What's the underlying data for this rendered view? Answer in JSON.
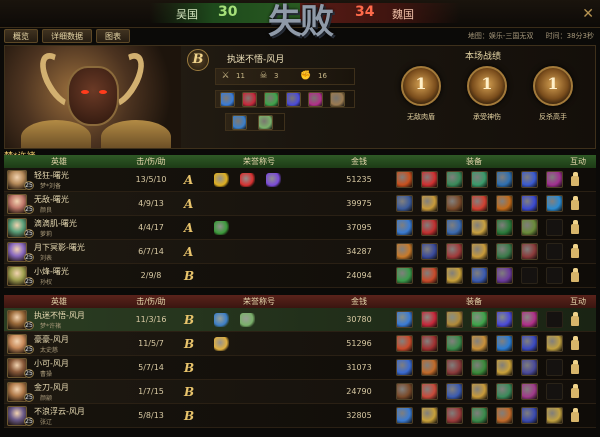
{
  "header": {
    "left_team": "吴国",
    "left_score": "30",
    "right_team": "魏国",
    "right_score": "34",
    "result": "失败",
    "close_icon": "close-icon"
  },
  "tabs": [
    {
      "label": "概览"
    },
    {
      "label": "详细数据"
    },
    {
      "label": "图表"
    }
  ],
  "meta": {
    "map": "地图：娱乐-三国无双",
    "time": "时间：38分3秒"
  },
  "mvp": {
    "grade": "B",
    "name": "执迷不悟-风月",
    "stats": [
      {
        "icon": "swords-icon",
        "value": "11"
      },
      {
        "icon": "skull-icon",
        "value": "3"
      },
      {
        "icon": "fist-icon",
        "value": "16"
      }
    ],
    "items": [
      "#3a7bd5",
      "#c6283a",
      "#3fa34a",
      "#4b4bd8",
      "#b03088",
      "#9a7a50"
    ],
    "titles": [
      "#3c7fc8",
      "#7ab06a"
    ]
  },
  "record": {
    "title": "本场战绩",
    "medals": [
      {
        "num": "1",
        "label": "无敌肉盾"
      },
      {
        "num": "1",
        "label": "承受神伤"
      },
      {
        "num": "1",
        "label": "反杀高手"
      }
    ]
  },
  "section_name": "梦*许褚",
  "columns": {
    "hero": "英雄",
    "kda": "击/伤/助",
    "title": "荣誉称号",
    "gold": "金钱",
    "equip": "装备",
    "interact": "互动"
  },
  "team_green": [
    {
      "hero": "轻狂-曙光",
      "player": "梦*刘备",
      "lvl": "25",
      "kda": "13/5/10",
      "grade": "A",
      "gold": "51235",
      "avatar": "#b58a5a",
      "titles": [
        "#e0b020",
        "#d83030",
        "#7a4ad8"
      ],
      "items": [
        "#c8501e",
        "#d03030",
        "#3a8a5a",
        "#3a9a6a",
        "#2e6fb0",
        "#3a5ad0",
        "#a03090"
      ]
    },
    {
      "hero": "无敌-曙光",
      "player": "颜良",
      "lvl": "25",
      "kda": "4/9/13",
      "grade": "A",
      "gold": "39975",
      "avatar": "#c0786a",
      "titles": [],
      "items": [
        "#3a5a9a",
        "#c89a3a",
        "#7a4a2a",
        "#d04030",
        "#c06a1a",
        "#3a4ad0",
        "#2a8ad0"
      ]
    },
    {
      "hero": "滴滴肌-曙光",
      "player": "萝莉",
      "lvl": "25",
      "kda": "4/4/17",
      "grade": "A",
      "gold": "37095",
      "avatar": "#5aa07a",
      "titles": [
        "#3a9a3a"
      ],
      "items": [
        "#3a7ad0",
        "#c03030",
        "#3a6ab0",
        "#c8a040",
        "#2a7a3a",
        "#6a8a3a",
        ""
      ]
    },
    {
      "hero": "月下冥影-曙光",
      "player": "刘表",
      "lvl": "25",
      "kda": "6/7/14",
      "grade": "A",
      "gold": "34287",
      "avatar": "#8a6ac0",
      "titles": [],
      "items": [
        "#c87a2a",
        "#3a4a9a",
        "#a03a3a",
        "#c89a3a",
        "#3a7a4a",
        "#8a3a3a",
        ""
      ]
    },
    {
      "hero": "小烽-曙光",
      "player": "孙权",
      "lvl": "25",
      "kda": "2/9/8",
      "grade": "B",
      "gold": "24094",
      "avatar": "#a0a050",
      "titles": [],
      "items": [
        "#3a9a4a",
        "#c84a2a",
        "#c8a03a",
        "#3a5ab0",
        "#6a3a9a",
        "",
        ""
      ]
    }
  ],
  "team_red": [
    {
      "hero": "执迷不悟-风月",
      "player": "梦*许褚",
      "lvl": "25",
      "kda": "11/3/16",
      "grade": "B",
      "gold": "30780",
      "avatar": "#9a6a3a",
      "titles": [
        "#3c7fc8",
        "#7ab06a"
      ],
      "self": true,
      "items": [
        "#3a7bd5",
        "#c6283a",
        "#b08a3a",
        "#3fa34a",
        "#4b4bd8",
        "#b03088",
        ""
      ]
    },
    {
      "hero": "豪豪-风月",
      "player": "太史慈",
      "lvl": "25",
      "kda": "11/5/7",
      "grade": "B",
      "gold": "51296",
      "avatar": "#c88a5a",
      "titles": [
        "#e0b040"
      ],
      "items": [
        "#c84a2a",
        "#a03030",
        "#3a8a4a",
        "#c8903a",
        "#2a7ad0",
        "#3a4ac0",
        "#c0a040"
      ]
    },
    {
      "hero": "小可-风月",
      "player": "曹操",
      "lvl": "25",
      "kda": "5/7/14",
      "grade": "B",
      "gold": "31073",
      "avatar": "#8a5a3a",
      "titles": [],
      "items": [
        "#3a6ad0",
        "#c06a2a",
        "#8a3a3a",
        "#3a8a3a",
        "#c8a03a",
        "#4a4a9a",
        ""
      ]
    },
    {
      "hero": "金刀-风月",
      "player": "颜颛",
      "lvl": "25",
      "kda": "1/7/15",
      "grade": "B",
      "gold": "24790",
      "avatar": "#b07a4a",
      "titles": [],
      "items": [
        "#7a4a2a",
        "#c84a3a",
        "#3a5ab0",
        "#c89a3a",
        "#3a8a5a",
        "#a03a8a",
        ""
      ]
    },
    {
      "hero": "不浪浮云-风月",
      "player": "张辽",
      "lvl": "25",
      "kda": "5/8/13",
      "grade": "B",
      "gold": "32805",
      "avatar": "#6a5a8a",
      "titles": [],
      "items": [
        "#3a7ad0",
        "#c8a03a",
        "#9a3a3a",
        "#3a8a4a",
        "#c06a2a",
        "#3a4ab0",
        "#c0a040"
      ]
    }
  ]
}
